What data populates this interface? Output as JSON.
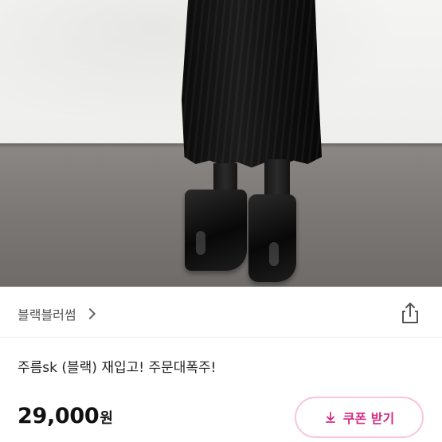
{
  "product": {
    "image_alt": "product-photo-black-pleated-skirt",
    "seller_name": "블랙블러썸",
    "title": "주름sk (블랙) 재입고! 주문대폭주!",
    "price_amount": "29,000",
    "price_unit": "원",
    "coupon_label": "쿠폰 받기"
  },
  "icons": {
    "seller_chevron": "chevron-right-icon",
    "share": "share-icon",
    "coupon": "download-arrow-icon"
  },
  "colors": {
    "coupon_text": "#d32c82",
    "coupon_border": "#f7c5dd"
  }
}
